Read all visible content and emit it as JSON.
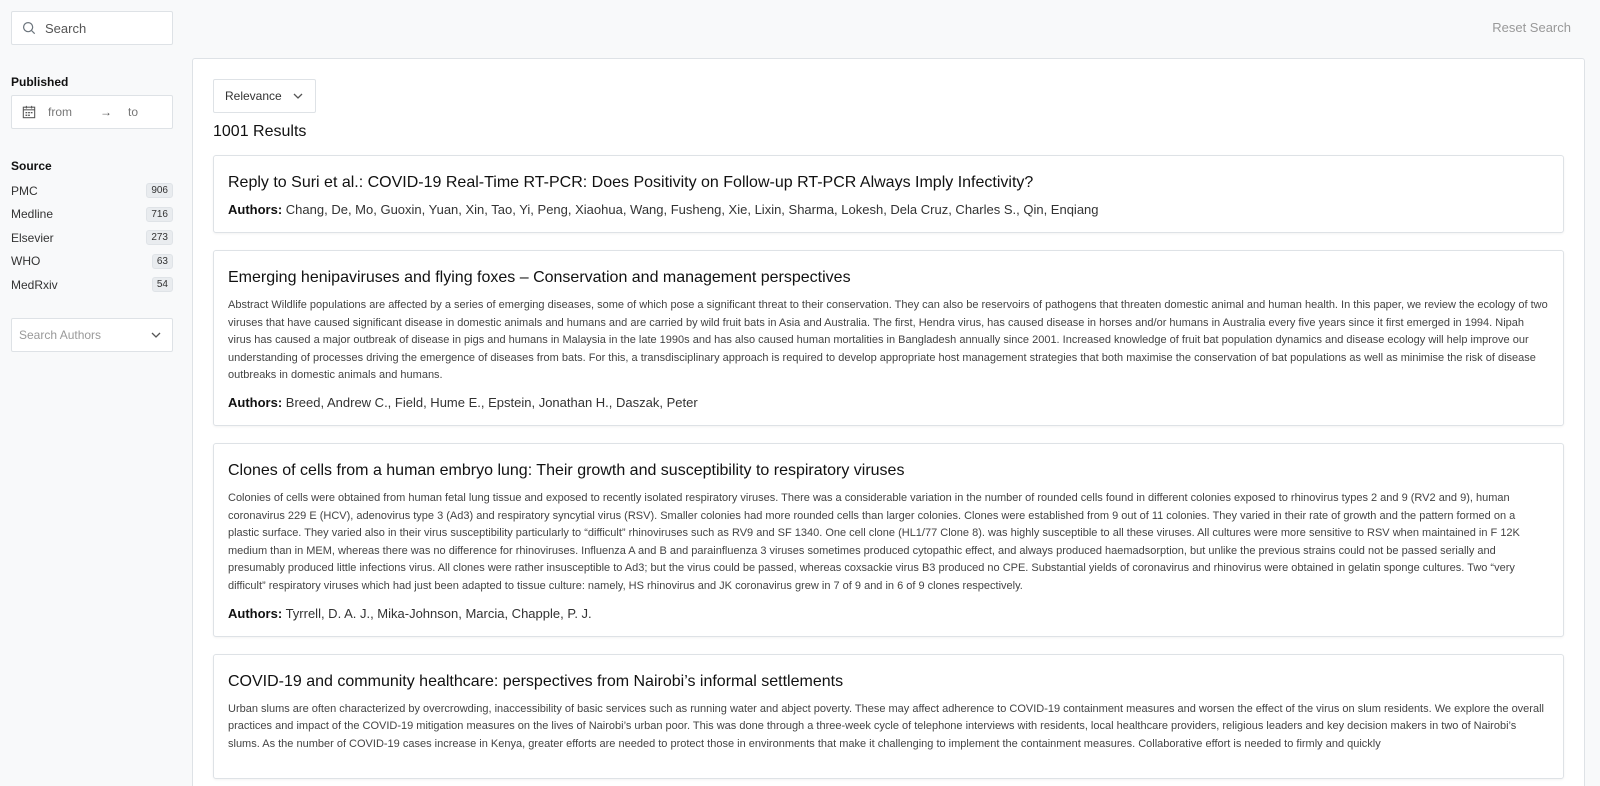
{
  "search": {
    "placeholder": "Search"
  },
  "published": {
    "label": "Published",
    "from_placeholder": "from",
    "arrow": "→",
    "to_placeholder": "to"
  },
  "source": {
    "label": "Source",
    "items": [
      {
        "name": "PMC",
        "count": "906"
      },
      {
        "name": "Medline",
        "count": "716"
      },
      {
        "name": "Elsevier",
        "count": "273"
      },
      {
        "name": "WHO",
        "count": "63"
      },
      {
        "name": "MedRxiv",
        "count": "54"
      }
    ]
  },
  "authors_filter": {
    "placeholder": "Search Authors"
  },
  "reset_label": "Reset Search",
  "sort": {
    "selected": "Relevance"
  },
  "results_count": "1001 Results",
  "authors_label": "Authors:",
  "results": [
    {
      "title": "Reply to Suri et al.: COVID-19 Real-Time RT-PCR: Does Positivity on Follow-up RT-PCR Always Imply Infectivity?",
      "abstract": "",
      "authors": "Chang, De, Mo, Guoxin, Yuan, Xin, Tao, Yi, Peng, Xiaohua, Wang, Fusheng, Xie, Lixin, Sharma, Lokesh, Dela Cruz, Charles S., Qin, Enqiang"
    },
    {
      "title": "Emerging henipaviruses and flying foxes – Conservation and management perspectives",
      "abstract": "Abstract Wildlife populations are affected by a series of emerging diseases, some of which pose a significant threat to their conservation. They can also be reservoirs of pathogens that threaten domestic animal and human health. In this paper, we review the ecology of two viruses that have caused significant disease in domestic animals and humans and are carried by wild fruit bats in Asia and Australia. The first, Hendra virus, has caused disease in horses and/or humans in Australia every five years since it first emerged in 1994. Nipah virus has caused a major outbreak of disease in pigs and humans in Malaysia in the late 1990s and has also caused human mortalities in Bangladesh annually since 2001. Increased knowledge of fruit bat population dynamics and disease ecology will help improve our understanding of processes driving the emergence of diseases from bats. For this, a transdisciplinary approach is required to develop appropriate host management strategies that both maximise the conservation of bat populations as well as minimise the risk of disease outbreaks in domestic animals and humans.",
      "authors": "Breed, Andrew C., Field, Hume E., Epstein, Jonathan H., Daszak, Peter"
    },
    {
      "title": "Clones of cells from a human embryo lung: Their growth and susceptibility to respiratory viruses",
      "abstract": "Colonies of cells were obtained from human fetal lung tissue and exposed to recently isolated respiratory viruses. There was a considerable variation in the number of rounded cells found in different colonies exposed to rhinovirus types 2 and 9 (RV2 and 9), human coronavirus 229 E (HCV), adenovirus type 3 (Ad3) and respiratory syncytial virus (RSV). Smaller colonies had more rounded cells than larger colonies. Clones were established from 9 out of 11 colonies. They varied in their rate of growth and the pattern formed on a plastic surface. They varied also in their virus susceptibility particularly to “difficult” rhinoviruses such as RV9 and SF 1340. One cell clone (HL1/77 Clone 8). was highly susceptible to all these viruses. All cultures were more sensitive to RSV when maintained in F 12K medium than in MEM, whereas there was no difference for rhinoviruses. Influenza A and B and parainfluenza 3 viruses sometimes produced cytopathic effect, and always produced haemadsorption, but unlike the previous strains could not be passed serially and presumably produced little infections virus. All clones were rather insusceptible to Ad3; but the virus could be passed, whereas coxsackie virus B3 produced no CPE. Substantial yields of coronavirus and rhinovirus were obtained in gelatin sponge cultures. Two “very difficult” respiratory viruses which had just been adapted to tissue culture: namely, HS rhinovirus and JK coronavirus grew in 7 of 9 and in 6 of 9 clones respectively.",
      "authors": "Tyrrell, D. A. J., Mika-Johnson, Marcia, Chapple, P. J."
    },
    {
      "title": "COVID-19 and community healthcare: perspectives from Nairobi’s informal settlements",
      "abstract": "Urban slums are often characterized by overcrowding, inaccessibility of basic services such as running water and abject poverty. These may affect adherence to COVID-19 containment measures and worsen the effect of the virus on slum residents. We explore the overall practices and impact of the COVID-19 mitigation measures on the lives of Nairobi’s urban poor. This was done through a three-week cycle of telephone interviews with residents, local healthcare providers, religious leaders and key decision makers in two of Nairobi’s slums. As the number of COVID-19 cases increase in Kenya, greater efforts are needed to protect those in environments that make it challenging to implement the containment measures. Collaborative effort is needed to firmly and quickly",
      "authors": ""
    }
  ]
}
